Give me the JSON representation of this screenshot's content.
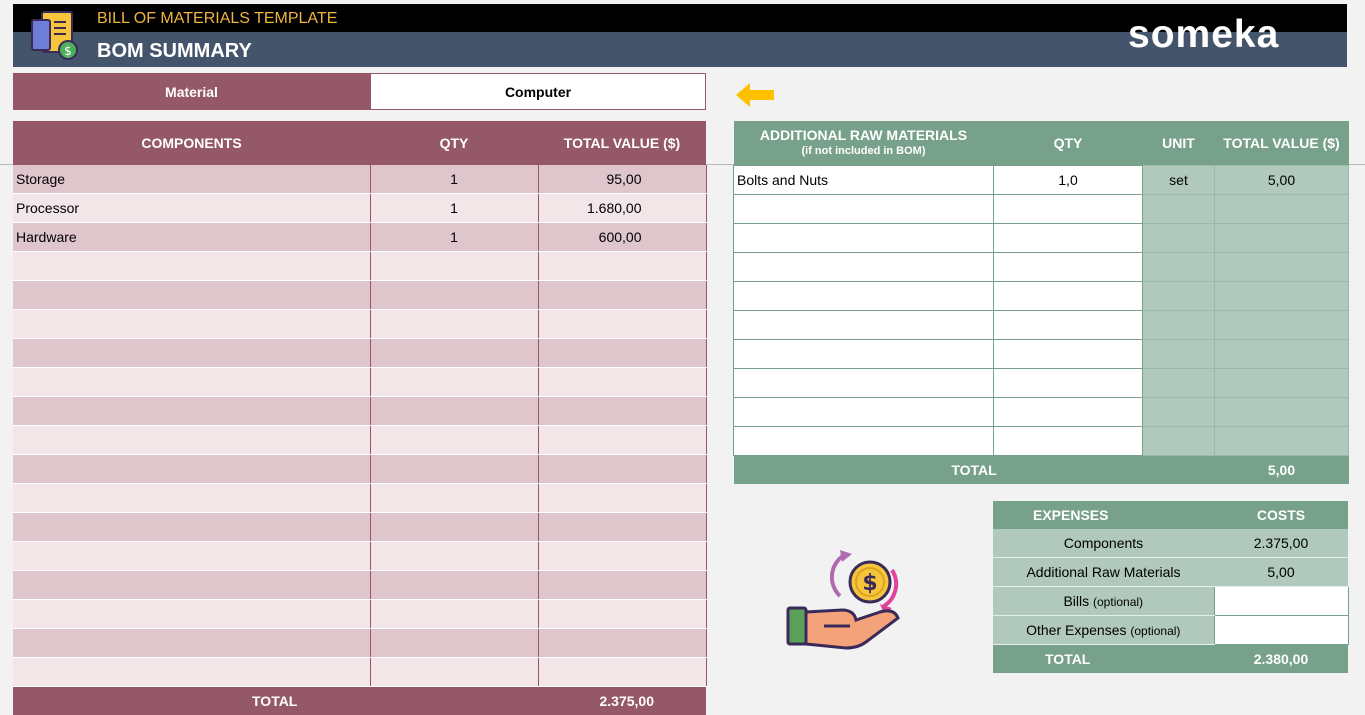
{
  "header": {
    "app_title": "BILL OF MATERIALS TEMPLATE",
    "page_title": "BOM SUMMARY",
    "brand": "someka",
    "logo_icon": "document-money-icon"
  },
  "selector": {
    "label": "Material",
    "value": "Computer",
    "pointer_icon": "arrow-left-icon"
  },
  "components": {
    "headers": [
      "COMPONENTS",
      "QTY",
      "TOTAL VALUE ($)"
    ],
    "rows": [
      [
        "Storage",
        "1",
        "95,00"
      ],
      [
        "Processor",
        "1",
        "1.680,00"
      ],
      [
        "Hardware",
        "1",
        "600,00"
      ],
      [
        "",
        "",
        ""
      ],
      [
        "",
        "",
        ""
      ],
      [
        "",
        "",
        ""
      ],
      [
        "",
        "",
        ""
      ],
      [
        "",
        "",
        ""
      ],
      [
        "",
        "",
        ""
      ],
      [
        "",
        "",
        ""
      ],
      [
        "",
        "",
        ""
      ],
      [
        "",
        "",
        ""
      ],
      [
        "",
        "",
        ""
      ],
      [
        "",
        "",
        ""
      ],
      [
        "",
        "",
        ""
      ],
      [
        "",
        "",
        ""
      ],
      [
        "",
        "",
        ""
      ],
      [
        "",
        "",
        ""
      ]
    ],
    "total_label": "TOTAL",
    "total_value": "2.375,00"
  },
  "raw_materials": {
    "headers": [
      "ADDITIONAL RAW MATERIALS",
      "QTY",
      "UNIT",
      "TOTAL VALUE ($)"
    ],
    "subheader": "(if not included in BOM)",
    "rows": [
      [
        "Bolts and Nuts",
        "1,0",
        "set",
        "5,00"
      ],
      [
        "",
        "",
        "",
        ""
      ],
      [
        "",
        "",
        "",
        ""
      ],
      [
        "",
        "",
        "",
        ""
      ],
      [
        "",
        "",
        "",
        ""
      ],
      [
        "",
        "",
        "",
        ""
      ],
      [
        "",
        "",
        "",
        ""
      ],
      [
        "",
        "",
        "",
        ""
      ],
      [
        "",
        "",
        "",
        ""
      ],
      [
        "",
        "",
        "",
        ""
      ]
    ],
    "total_label": "TOTAL",
    "total_value": "5,00"
  },
  "expenses": {
    "headers": [
      "EXPENSES",
      "COSTS"
    ],
    "rows": [
      {
        "label": "Components",
        "note": "",
        "value": "2.375,00"
      },
      {
        "label": "Additional Raw Materials",
        "note": "",
        "value": "5,00"
      },
      {
        "label": "Bills",
        "note": "(optional)",
        "value": ""
      },
      {
        "label": "Other Expenses",
        "note": "(optional)",
        "value": ""
      }
    ],
    "total_label": "TOTAL",
    "total_value": "2.380,00"
  },
  "illustration_icon": "hand-money-icon",
  "colors": {
    "header_dark": "#000000",
    "header_slate": "#44546a",
    "accent_title": "#f0b440",
    "mauve": "#955868",
    "mauve_light": "#dfc6cd",
    "green": "#77a18b",
    "green_light": "#b0c9bc"
  }
}
